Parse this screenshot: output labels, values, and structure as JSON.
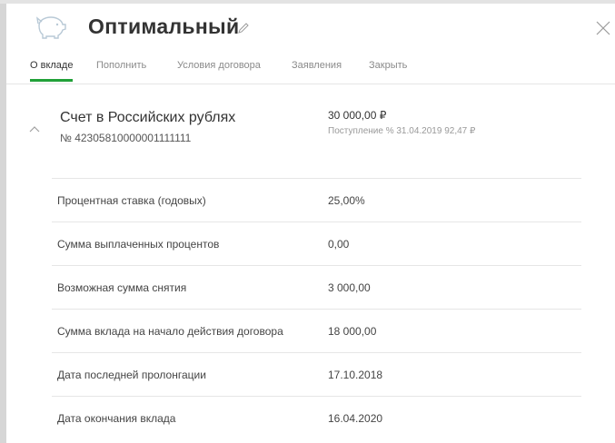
{
  "header": {
    "title": "Оптимальный",
    "icons": {
      "piggy": "piggy-bank-icon",
      "edit": "pencil-icon",
      "close": "close-icon"
    }
  },
  "tabs": [
    {
      "label": "О вкладе",
      "active": true
    },
    {
      "label": "Пополнить",
      "active": false
    },
    {
      "label": "Условия договора",
      "active": false
    },
    {
      "label": "Заявления",
      "active": false
    },
    {
      "label": "Закрыть",
      "active": false
    }
  ],
  "account": {
    "name": "Счет в Российских рублях",
    "number": "№ 42305810000001111111",
    "amount": "30 000,00 ₽",
    "interest_note": "Поступление % 31.04.2019 92,47 ₽"
  },
  "details": [
    {
      "label": "Процентная ставка (годовых)",
      "value": "25,00%"
    },
    {
      "label": "Сумма выплаченных процентов",
      "value": "0,00"
    },
    {
      "label": "Возможная сумма снятия",
      "value": "3 000,00"
    },
    {
      "label": "Сумма вклада на начало действия договора",
      "value": "18 000,00"
    },
    {
      "label": "Дата последней пролонгации",
      "value": "17.10.2018"
    },
    {
      "label": "Дата окончания вклада",
      "value": "16.04.2020"
    }
  ],
  "colors": {
    "accent": "#21a038",
    "text": "#333333",
    "muted": "#8a8a8a",
    "divider": "#e6e6e6"
  }
}
